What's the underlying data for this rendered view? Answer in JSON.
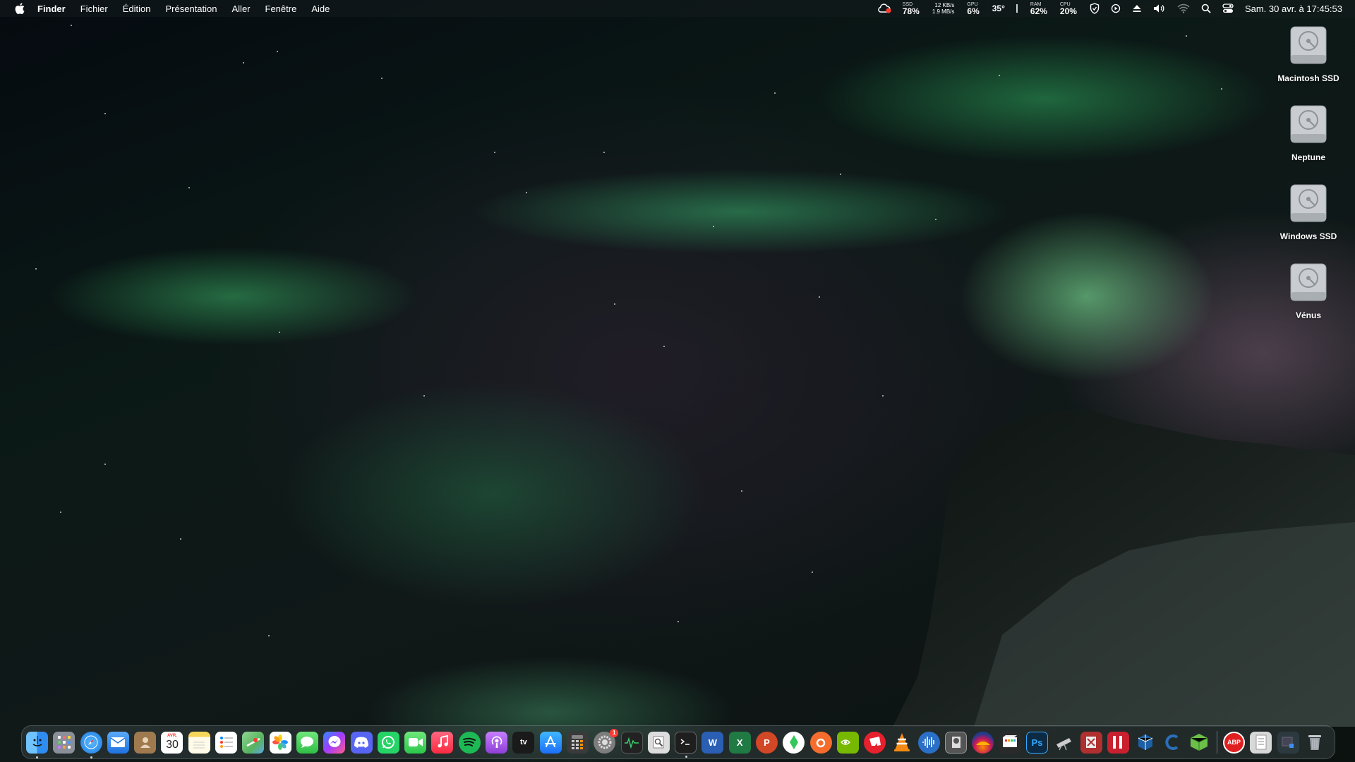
{
  "menubar": {
    "app_name": "Finder",
    "menus": [
      "Fichier",
      "Édition",
      "Présentation",
      "Aller",
      "Fenêtre",
      "Aide"
    ],
    "stats": {
      "ssd_label": "SSD",
      "ssd_value": "78%",
      "net_up": "12 KB/s",
      "net_down": "1.9 MB/s",
      "gpu_label": "GPU",
      "gpu_value": "6%",
      "temp": "35°",
      "ram_label": "RAM",
      "ram_value": "62%",
      "cpu_label": "CPU",
      "cpu_value": "20%"
    },
    "clock": "Sam. 30 avr. à  17:45:53"
  },
  "desktop": {
    "volumes": [
      "Macintosh SSD",
      "Neptune",
      "Windows SSD",
      "Vénus"
    ]
  },
  "dock": {
    "calendar_month": "AVR.",
    "calendar_day": "30",
    "settings_badge": "1",
    "apps": [
      {
        "name": "Finder",
        "icon": "finder-icon",
        "color": "#2f8cf0"
      },
      {
        "name": "Launchpad",
        "icon": "launchpad-icon",
        "color": "#8a8f99"
      },
      {
        "name": "Safari",
        "icon": "safari-icon",
        "color": "#1f7ae0"
      },
      {
        "name": "Mail",
        "icon": "mail-icon",
        "color": "#3b8ff5"
      },
      {
        "name": "Contacts",
        "icon": "contacts-icon",
        "color": "#a07a4f"
      },
      {
        "name": "Calendar",
        "icon": "calendar-icon",
        "color": "#ffffff"
      },
      {
        "name": "Notes",
        "icon": "notes-icon",
        "color": "#f6d659"
      },
      {
        "name": "Reminders",
        "icon": "reminders-icon",
        "color": "#ffffff"
      },
      {
        "name": "Maps",
        "icon": "maps-icon",
        "color": "#58b35e"
      },
      {
        "name": "Photos",
        "icon": "photos-icon",
        "color": "#ffffff"
      },
      {
        "name": "Messages",
        "icon": "messages-icon",
        "color": "#35c759"
      },
      {
        "name": "Messenger",
        "icon": "messenger-icon",
        "color": "#8a4dff"
      },
      {
        "name": "Discord",
        "icon": "discord-icon",
        "color": "#5865f2"
      },
      {
        "name": "WhatsApp",
        "icon": "whatsapp-icon",
        "color": "#25d366"
      },
      {
        "name": "FaceTime",
        "icon": "facetime-icon",
        "color": "#2bc84b"
      },
      {
        "name": "Music",
        "icon": "music-icon",
        "color": "#fa3c4c"
      },
      {
        "name": "Spotify",
        "icon": "spotify-icon",
        "color": "#1db954"
      },
      {
        "name": "Podcasts",
        "icon": "podcasts-icon",
        "color": "#9b51e0"
      },
      {
        "name": "Apple TV",
        "icon": "appletv-icon",
        "color": "#1a1a1a"
      },
      {
        "name": "App Store",
        "icon": "appstore-icon",
        "color": "#1c8ef9"
      },
      {
        "name": "Calculator",
        "icon": "calculator-icon",
        "color": "#3a3a3a"
      },
      {
        "name": "System Preferences",
        "icon": "settings-icon",
        "color": "#7d7d7d"
      },
      {
        "name": "Activity Monitor",
        "icon": "activity-monitor-icon",
        "color": "#222222"
      },
      {
        "name": "Preview",
        "icon": "preview-icon",
        "color": "#dddddd"
      },
      {
        "name": "Terminal",
        "icon": "terminal-icon",
        "color": "#1e1e1e"
      },
      {
        "name": "Word",
        "icon": "word-icon",
        "color": "#2b5fb4"
      },
      {
        "name": "Excel",
        "icon": "excel-icon",
        "color": "#1f7a43"
      },
      {
        "name": "PowerPoint",
        "icon": "powerpoint-icon",
        "color": "#d24726"
      },
      {
        "name": "The Sims",
        "icon": "sims-icon",
        "color": "#ffffff"
      },
      {
        "name": "Origin",
        "icon": "origin-icon",
        "color": "#f56c2d"
      },
      {
        "name": "GeForce NOW",
        "icon": "nvidia-icon",
        "color": "#76b900"
      },
      {
        "name": "Epic/Riot",
        "icon": "riot-icon",
        "color": "#e6212d"
      },
      {
        "name": "VLC",
        "icon": "vlc-icon",
        "color": "#f48a13"
      },
      {
        "name": "Audio App",
        "icon": "audio-icon",
        "color": "#2a6fc8"
      },
      {
        "name": "Utility",
        "icon": "utility-icon",
        "color": "#555555"
      },
      {
        "name": "Weather App",
        "icon": "weather-icon",
        "color": "#223b8c"
      },
      {
        "name": "Final Cut Pro",
        "icon": "finalcut-icon",
        "color": "#2a2a2a"
      },
      {
        "name": "Photoshop",
        "icon": "photoshop-icon",
        "color": "#0d2a44"
      },
      {
        "name": "Telescope App",
        "icon": "telescope-icon",
        "color": "#444444"
      },
      {
        "name": "Tool App",
        "icon": "tool-icon",
        "color": "#b03030"
      },
      {
        "name": "Parallels",
        "icon": "parallels-icon",
        "color": "#c8202f"
      },
      {
        "name": "VirtualBox",
        "icon": "virtualbox-icon",
        "color": "#1d5fa4"
      },
      {
        "name": "CCleaner",
        "icon": "ccleaner-icon",
        "color": "#2a6fb8"
      },
      {
        "name": "Box App",
        "icon": "box-icon",
        "color": "#6cc04a"
      }
    ],
    "extras": [
      {
        "name": "AdBlock Plus",
        "icon": "adblock-icon",
        "color": "#e02020"
      },
      {
        "name": "Document",
        "icon": "document-icon",
        "color": "#d8d8d8"
      },
      {
        "name": "Downloads",
        "icon": "downloads-icon",
        "color": "#2c3a40"
      },
      {
        "name": "Trash",
        "icon": "trash-icon",
        "color": "#9aa0a6"
      }
    ]
  }
}
